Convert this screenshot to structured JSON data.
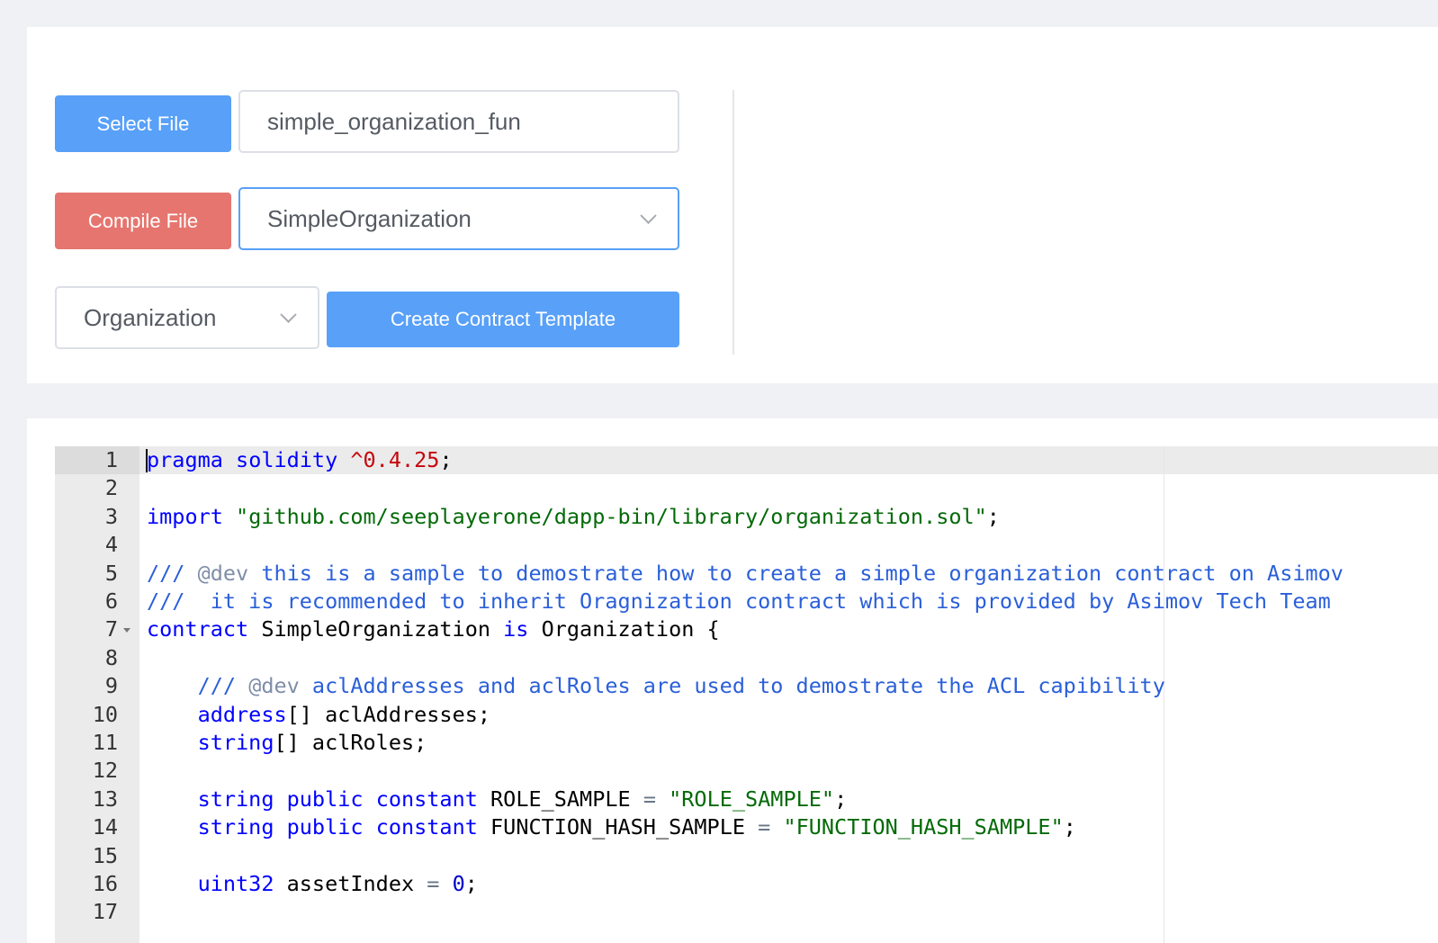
{
  "toolbar": {
    "select_file_label": "Select File",
    "file_name_value": "simple_organization_fun",
    "compile_file_label": "Compile File",
    "contract_select_value": "SimpleOrganization",
    "template_type_value": "Organization",
    "create_template_label": "Create Contract Template"
  },
  "editor": {
    "line_numbers": [
      "1",
      "2",
      "3",
      "4",
      "5",
      "6",
      "7",
      "8",
      "9",
      "10",
      "11",
      "12",
      "13",
      "14",
      "15",
      "16",
      "17"
    ],
    "lines": {
      "l1": {
        "a": "pragma",
        "b": " ",
        "c": "solidity",
        "d": " ",
        "e": "^0.4.25",
        "f": ";"
      },
      "l3": {
        "a": "import",
        "b": " ",
        "c": "\"github.com/seeplayerone/dapp-bin/library/organization.sol\"",
        "d": ";"
      },
      "l5": {
        "a": "/// ",
        "b": "@dev",
        "c": " this is a sample to demostrate how to create a simple organization contract on Asimov"
      },
      "l6": {
        "a": "///  it is recommended to inherit Oragnization contract which is provided by Asimov Tech Team"
      },
      "l7": {
        "a": "contract",
        "b": " SimpleOrganization ",
        "c": "is",
        "d": " Organization {"
      },
      "l9": {
        "indent": "    ",
        "a": "/// ",
        "b": "@dev",
        "c": " aclAddresses and aclRoles are used to demostrate the ACL capibility"
      },
      "l10": {
        "indent": "    ",
        "a": "address",
        "b": "[] aclAddresses;"
      },
      "l11": {
        "indent": "    ",
        "a": "string",
        "b": "[] aclRoles;"
      },
      "l13": {
        "indent": "    ",
        "a": "string",
        "b": " ",
        "c": "public",
        "d": " ",
        "e": "constant",
        "f": " ROLE_SAMPLE ",
        "g": "=",
        "h": " ",
        "i": "\"ROLE_SAMPLE\"",
        "j": ";"
      },
      "l14": {
        "indent": "    ",
        "a": "string",
        "b": " ",
        "c": "public",
        "d": " ",
        "e": "constant",
        "f": " FUNCTION_HASH_SAMPLE ",
        "g": "=",
        "h": " ",
        "i": "\"FUNCTION_HASH_SAMPLE\"",
        "j": ";"
      },
      "l16": {
        "indent": "    ",
        "a": "uint32",
        "b": " assetIndex ",
        "c": "=",
        "d": " ",
        "e": "0",
        "f": ";"
      }
    }
  }
}
